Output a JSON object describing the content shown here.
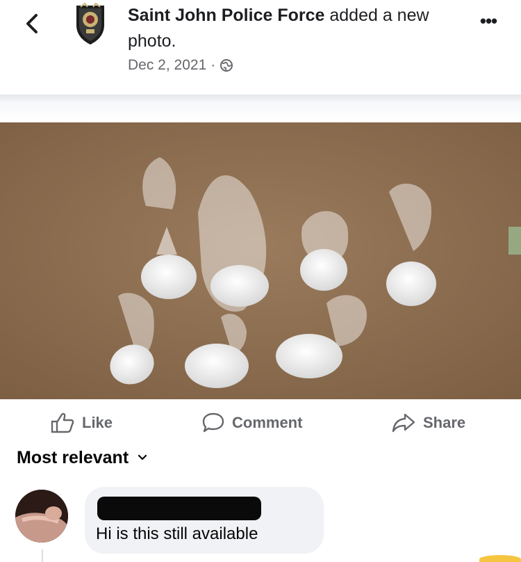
{
  "post": {
    "page_name": "Saint John Police Force",
    "action_text": " added a new photo.",
    "date": "Dec 2, 2021",
    "separator": "·",
    "privacy_icon": "globe-icon",
    "more_label": "•••"
  },
  "actions": {
    "like": "Like",
    "comment": "Comment",
    "share": "Share"
  },
  "comments": {
    "sort_label": "Most relevant",
    "items": [
      {
        "text": "Hi is this still available"
      }
    ]
  },
  "colors": {
    "secondary_text": "#65676b",
    "bubble_bg": "#f0f2f5",
    "photo_background": "#8a6a4c"
  }
}
